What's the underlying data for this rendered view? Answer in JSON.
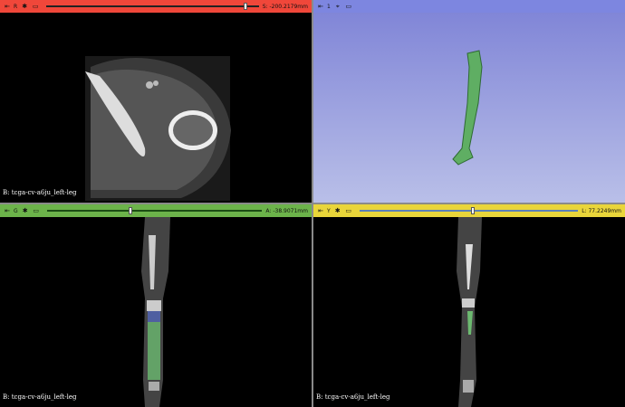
{
  "views": {
    "red": {
      "letter": "R",
      "offset": "S: -200.2179mm",
      "caption": "B: tcga-cv-a6ju_left-leg",
      "color": "#f0473a",
      "slider_fraction": 0.93
    },
    "threed": {
      "letter": "1",
      "color": "#7d86e0"
    },
    "green": {
      "letter": "G",
      "offset": "A: -38.9071mm",
      "caption": "B: tcga-cv-a6ju_left-leg",
      "color": "#6cb34a",
      "slider_fraction": 0.38
    },
    "yellow": {
      "letter": "Y",
      "offset": "L: 77.2249mm",
      "caption": "B: tcga-cv-a6ju_left-leg",
      "color": "#e9d53a",
      "slider_fraction": 0.51
    }
  },
  "icons": {
    "pin": "pin-icon",
    "link": "link-icon",
    "crosshair": "crosshair-icon",
    "maximize": "maximize-view-icon"
  }
}
